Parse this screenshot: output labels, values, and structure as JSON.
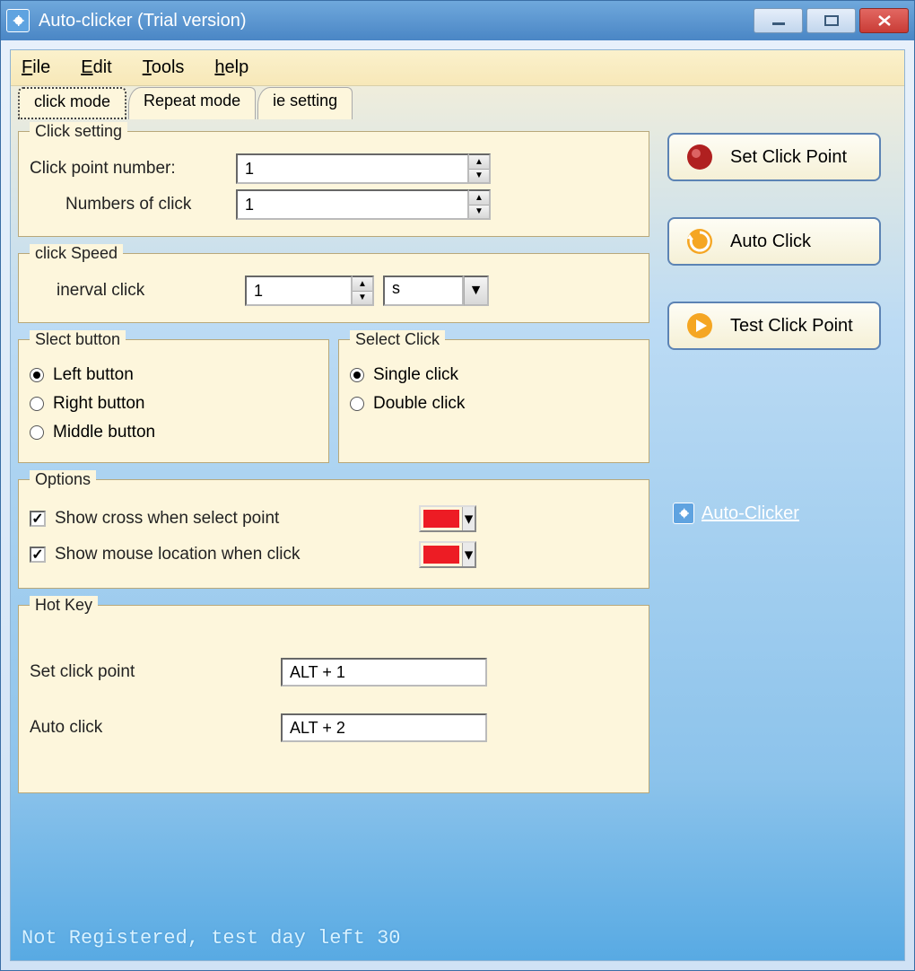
{
  "window": {
    "title": "Auto-clicker (Trial version)"
  },
  "menu": {
    "file": "File",
    "edit": "Edit",
    "tools": "Tools",
    "help": "help"
  },
  "tabs": {
    "click_mode": "click mode",
    "repeat_mode": "Repeat mode",
    "ie_setting": "ie setting"
  },
  "click_setting": {
    "legend": "Click setting",
    "point_number_label": "Click point number:",
    "point_number_value": "1",
    "num_clicks_label": "Numbers of click",
    "num_clicks_value": "1"
  },
  "click_speed": {
    "legend": "click Speed",
    "interval_label": "inerval click",
    "interval_value": "1",
    "unit_value": "s"
  },
  "select_button": {
    "legend": "Slect button",
    "left": "Left button",
    "right": "Right button",
    "middle": "Middle button"
  },
  "select_click": {
    "legend": "Select Click",
    "single": "Single click",
    "double": "Double click"
  },
  "options": {
    "legend": "Options",
    "show_cross": "Show cross when select point",
    "show_mouse": "Show mouse location when click",
    "cross_color": "#ed1c24",
    "mouse_color": "#ed1c24"
  },
  "hotkey": {
    "legend": "Hot Key",
    "set_label": "Set click point",
    "set_value": "ALT + 1",
    "auto_label": "Auto click",
    "auto_value": "ALT + 2"
  },
  "side": {
    "set_point": "Set Click Point",
    "auto_click": "Auto Click",
    "test_point": "Test Click Point",
    "link": "Auto-Clicker"
  },
  "status": "Not Registered, test day left 30"
}
